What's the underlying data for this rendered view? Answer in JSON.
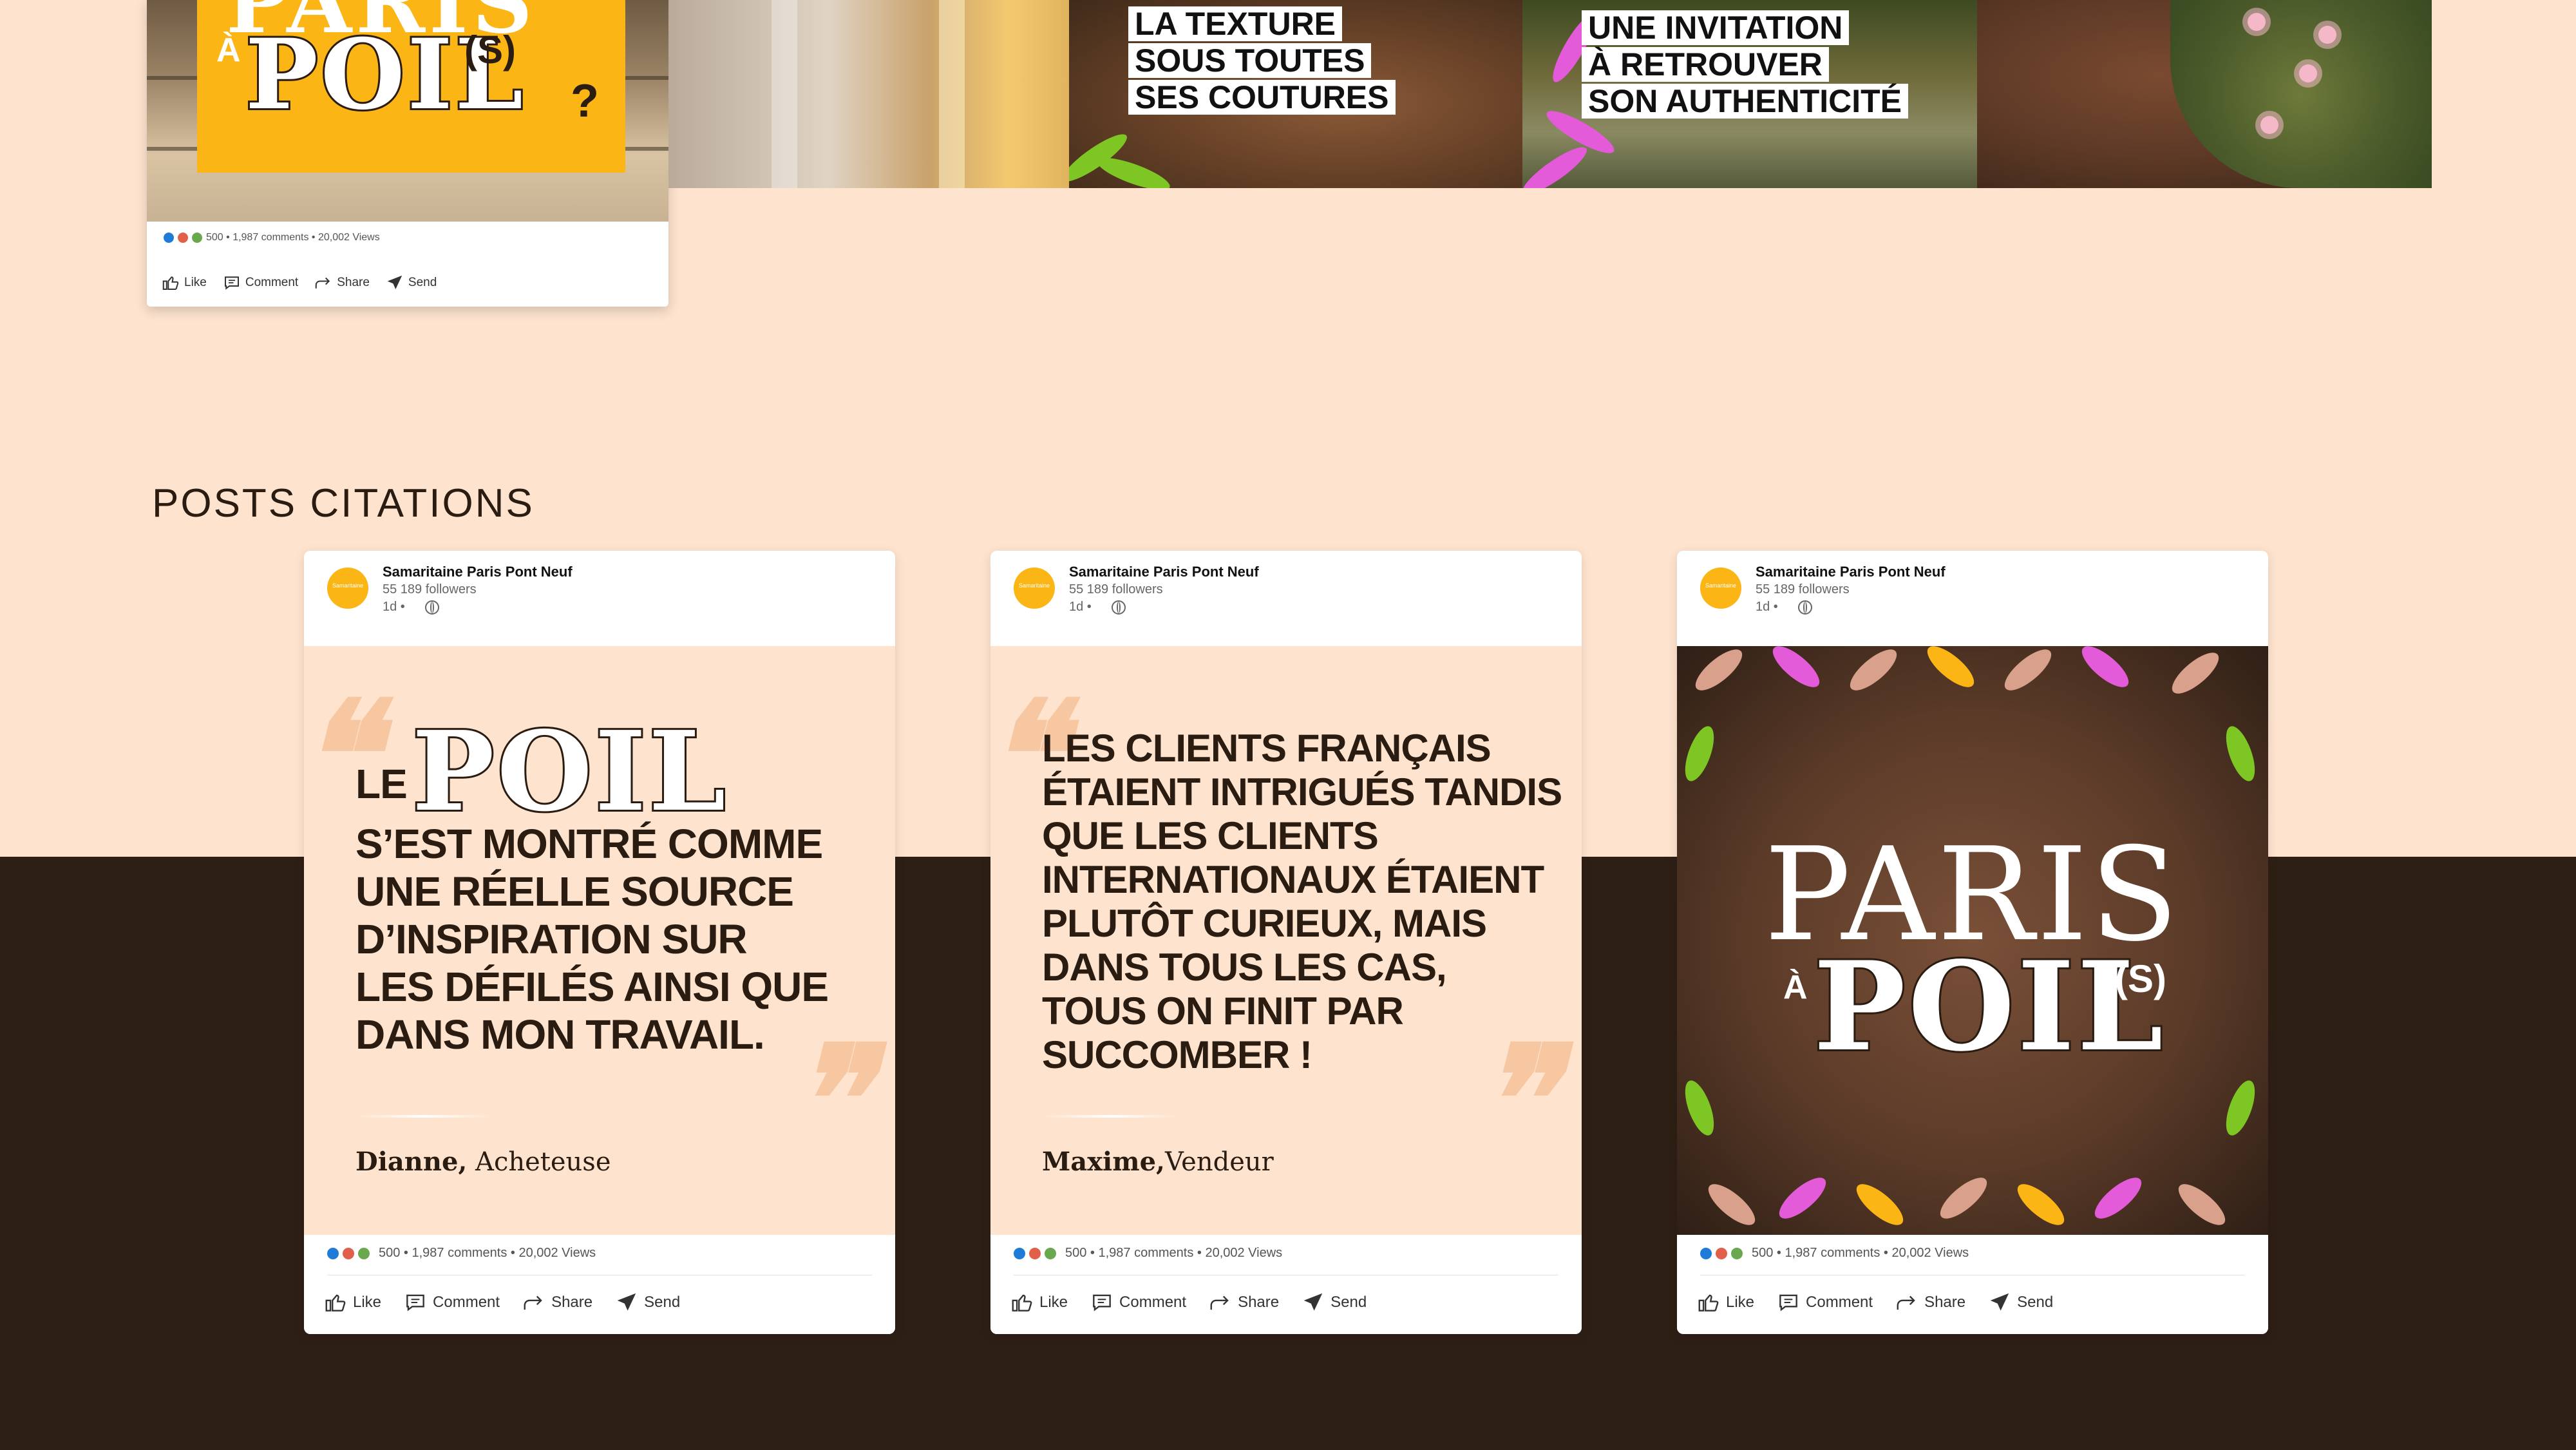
{
  "top_carousel": {
    "card": {
      "poster": {
        "top_word": "PARIS",
        "a": "À",
        "word": "POIL",
        "suffix": "(S)",
        "question": "?"
      },
      "stats": "500 • 1,987 comments • 20,002 Views",
      "actions": {
        "like": "Like",
        "comment": "Comment",
        "share": "Share",
        "send": "Send"
      }
    },
    "tiles": [
      {
        "caption_lines": [
          "LA TEXTURE",
          "SOUS TOUTES",
          "SES COUTURES"
        ]
      },
      {
        "caption_lines": [
          "UNE INVITATION",
          "À RETROUVER",
          "SON AUTHENTICITÉ"
        ]
      }
    ]
  },
  "section": {
    "title": "POSTS CITATIONS"
  },
  "posts": [
    {
      "author": "Samaritaine Paris Pont Neuf",
      "avatar_text": "Samaritaine",
      "followers": "55 189 followers",
      "time": "1d •",
      "quote_prefix": "LE",
      "quote_word": "POIL",
      "quote_lines": [
        "S’EST MONTRÉ COMME",
        "UNE RÉELLE SOURCE",
        "D’INSPIRATION SUR",
        "LES DÉFILÉS AINSI QUE",
        "DANS MON TRAVAIL."
      ],
      "signature_name": "Dianne,",
      "signature_role": " Acheteuse",
      "stats": "500 • 1,987 comments • 20,002 Views",
      "actions": {
        "like": "Like",
        "comment": "Comment",
        "share": "Share",
        "send": "Send"
      }
    },
    {
      "author": "Samaritaine Paris Pont Neuf",
      "avatar_text": "Samaritaine",
      "followers": "55 189 followers",
      "time": "1d •",
      "quote_lines": [
        "LES CLIENTS FRANÇAIS",
        "ÉTAIENT INTRIGUÉS TANDIS",
        "QUE LES CLIENTS",
        "INTERNATIONAUX ÉTAIENT",
        "PLUTÔT CURIEUX, MAIS",
        "DANS TOUS LES CAS,",
        "TOUS ON FINIT PAR",
        "SUCCOMBER !"
      ],
      "signature_name": "Maxime,",
      "signature_role": "Vendeur",
      "stats": "500 • 1,987 comments • 20,002 Views",
      "actions": {
        "like": "Like",
        "comment": "Comment",
        "share": "Share",
        "send": "Send"
      }
    },
    {
      "author": "Samaritaine Paris Pont Neuf",
      "avatar_text": "Samaritaine",
      "followers": "55 189 followers",
      "time": "1d •",
      "poster": {
        "top_word": "PARIS",
        "a": "À",
        "word": "POIL",
        "suffix": "(S)"
      },
      "stats": "500 • 1,987 comments • 20,002 Views",
      "actions": {
        "like": "Like",
        "comment": "Comment",
        "share": "Share",
        "send": "Send"
      }
    }
  ],
  "colors": {
    "page_background": "#fee4cf",
    "bottom_band": "#2e1f15",
    "brand_yellow": "#fbb515",
    "text_dark": "#2b1c12",
    "accent_green": "#7ec623",
    "accent_pink": "#e35bd8",
    "reaction_like": "#1f7bd8",
    "reaction_love": "#e2604a",
    "reaction_support": "#6aa84f"
  },
  "icons": [
    "like-icon",
    "comment-icon",
    "share-icon",
    "send-icon",
    "globe-icon",
    "quote-mark-icon"
  ]
}
